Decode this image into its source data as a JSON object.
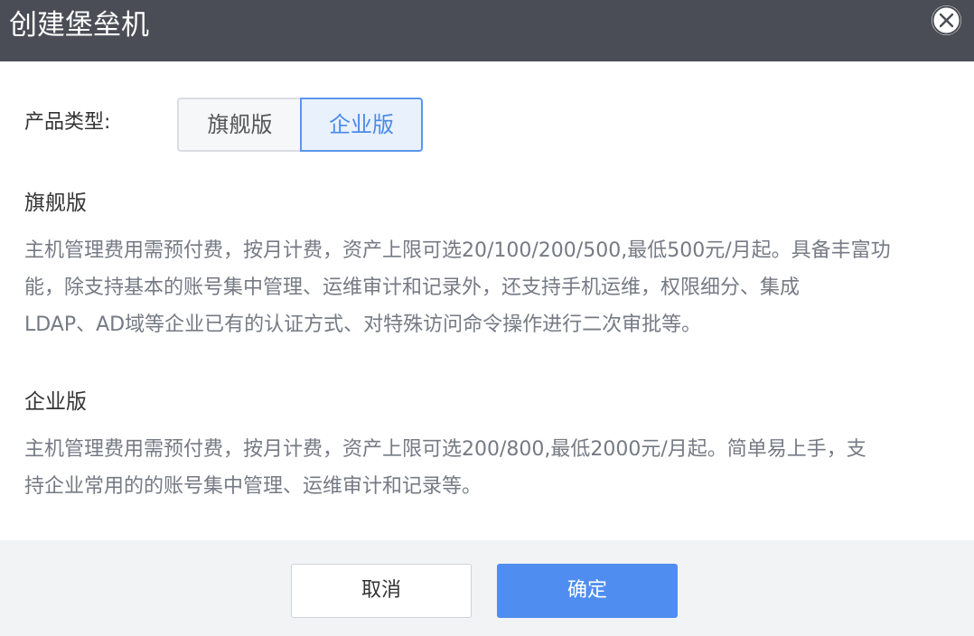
{
  "dialog": {
    "title": "创建堡垒机",
    "close_icon": "close-circle-icon"
  },
  "product_type": {
    "label": "产品类型:",
    "options": [
      {
        "label": "旗舰版",
        "selected": false
      },
      {
        "label": "企业版",
        "selected": true
      }
    ]
  },
  "sections": [
    {
      "title": "旗舰版",
      "lines": [
        "主机管理费用需预付费，按月计费，资产上限可选20/100/200/500,最低500元/月起。具备丰富功",
        "能，除支持基本的账号集中管理、运维审计和记录外，还支持手机运维，权限细分、集成",
        "LDAP、AD域等企业已有的认证方式、对特殊访问命令操作进行二次审批等。"
      ]
    },
    {
      "title": "企业版",
      "lines": [
        "主机管理费用需预付费，按月计费，资产上限可选200/800,最低2000元/月起。简单易上手，支",
        "持企业常用的的账号集中管理、运维审计和记录等。"
      ]
    }
  ],
  "footer": {
    "cancel_label": "取消",
    "confirm_label": "确定"
  },
  "colors": {
    "header_bg": "#4a4d55",
    "accent": "#4f8ef0",
    "selected_bg": "#e9f1fd",
    "footer_bg": "#f2f3f5"
  }
}
